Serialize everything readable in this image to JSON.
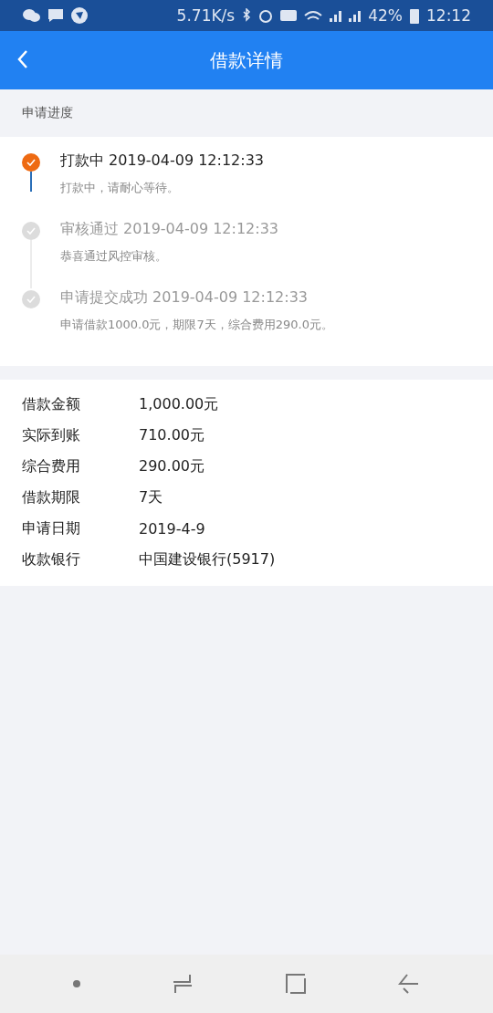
{
  "status_bar": {
    "speed": "5.71K/s",
    "battery": "42%",
    "time": "12:12"
  },
  "header": {
    "title": "借款详情"
  },
  "progress": {
    "label": "申请进度",
    "steps": [
      {
        "title": "打款中",
        "time": "2019-04-09 12:12:33",
        "note": "打款中，请耐心等待。",
        "active": true
      },
      {
        "title": "审核通过",
        "time": "2019-04-09 12:12:33",
        "note": "恭喜通过风控审核。",
        "active": false
      },
      {
        "title": "申请提交成功",
        "time": "2019-04-09 12:12:33",
        "note": "申请借款1000.0元，期限7天，综合费用290.0元。",
        "active": false
      }
    ]
  },
  "details": [
    {
      "label": "借款金额",
      "value": "1,000.00元"
    },
    {
      "label": "实际到账",
      "value": "710.00元"
    },
    {
      "label": "综合费用",
      "value": "290.00元"
    },
    {
      "label": "借款期限",
      "value": "7天"
    },
    {
      "label": "申请日期",
      "value": "2019-4-9"
    },
    {
      "label": "收款银行",
      "value": "中国建设银行(5917)"
    }
  ]
}
